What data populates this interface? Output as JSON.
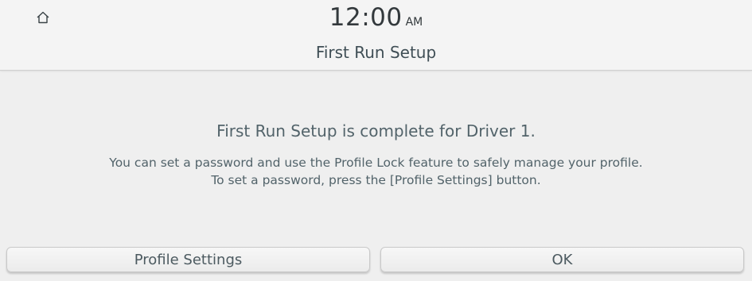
{
  "header": {
    "time": "12:00",
    "ampm": "AM",
    "title": "First Run Setup",
    "home_icon": "home-icon"
  },
  "message": {
    "title": "First Run Setup is complete for Driver 1.",
    "line1": "You can set a password and use the Profile Lock feature to safely manage your profile.",
    "line2": "To set a password, press the [Profile Settings] button."
  },
  "buttons": {
    "profile_settings": "Profile Settings",
    "ok": "OK"
  }
}
